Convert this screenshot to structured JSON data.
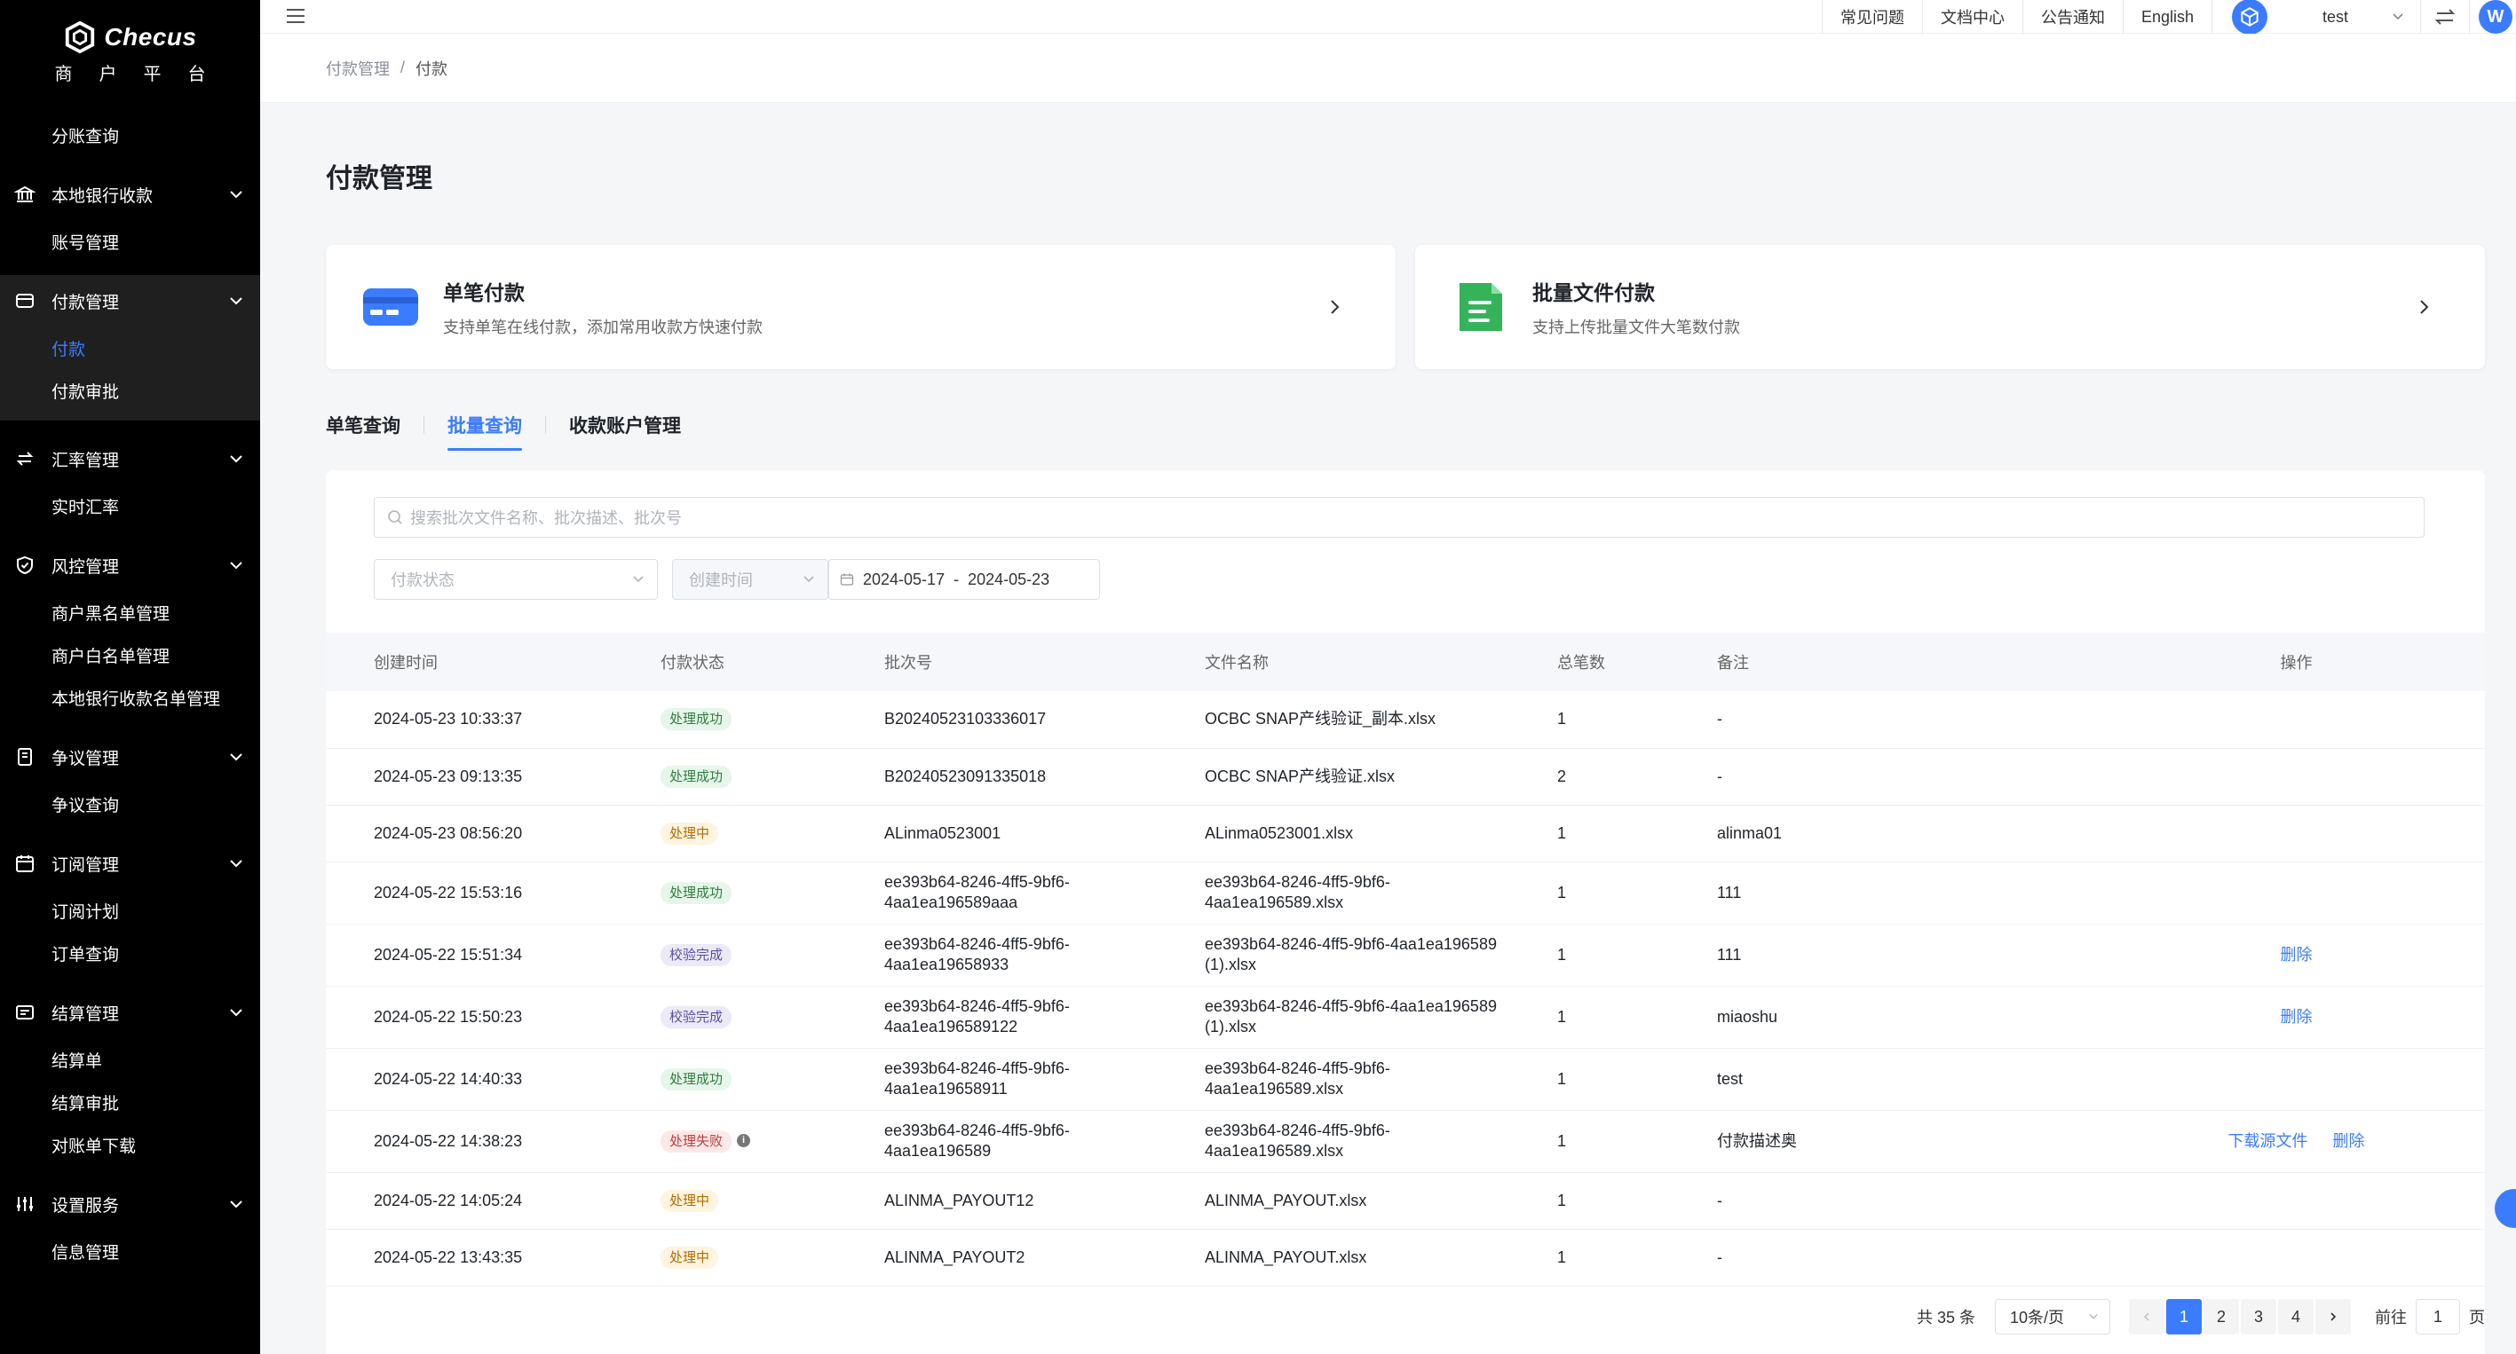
{
  "brand": {
    "name": "Checus",
    "subtitle": "商户平台"
  },
  "sidebar": {
    "top_items": [
      {
        "label": "分账查询"
      }
    ],
    "groups": [
      {
        "label": "本地银行收款",
        "icon": "bank-icon",
        "items": [
          "账号管理"
        ]
      },
      {
        "label": "付款管理",
        "icon": "payment-icon",
        "items": [
          "付款",
          "付款审批"
        ],
        "active_item": "付款"
      },
      {
        "label": "汇率管理",
        "icon": "exchange-icon",
        "items": [
          "实时汇率"
        ]
      },
      {
        "label": "风控管理",
        "icon": "shield-icon",
        "items": [
          "商户黑名单管理",
          "商户白名单管理",
          "本地银行收款名单管理"
        ]
      },
      {
        "label": "争议管理",
        "icon": "dispute-icon",
        "items": [
          "争议查询"
        ]
      },
      {
        "label": "订阅管理",
        "icon": "calendar-icon",
        "items": [
          "订阅计划",
          "订单查询"
        ]
      },
      {
        "label": "结算管理",
        "icon": "settlement-icon",
        "items": [
          "结算单",
          "结算审批",
          "对账单下载"
        ]
      },
      {
        "label": "设置服务",
        "icon": "sliders-icon",
        "items": [
          "信息管理"
        ]
      }
    ]
  },
  "topbar": {
    "links": [
      "常见问题",
      "文档中心",
      "公告通知",
      "English"
    ],
    "user": "test",
    "avatar_letter": "W"
  },
  "breadcrumb": {
    "parent": "付款管理",
    "sep": "/",
    "current": "付款"
  },
  "page_title": "付款管理",
  "cards": [
    {
      "title": "单笔付款",
      "desc": "支持单笔在线付款，添加常用收款方快速付款"
    },
    {
      "title": "批量文件付款",
      "desc": "支持上传批量文件大笔数付款"
    }
  ],
  "tabs": [
    {
      "label": "单笔查询"
    },
    {
      "label": "批量查询",
      "active": true
    },
    {
      "label": "收款账户管理"
    }
  ],
  "search": {
    "placeholder": "搜索批次文件名称、批次描述、批次号"
  },
  "filters": {
    "status_placeholder": "付款状态",
    "time_placeholder": "创建时间",
    "date_start": "2024-05-17",
    "date_sep": "-",
    "date_end": "2024-05-23"
  },
  "table": {
    "headers": [
      "创建时间",
      "付款状态",
      "批次号",
      "文件名称",
      "总笔数",
      "备注",
      "操作"
    ],
    "rows": [
      {
        "time": "2024-05-23 10:33:37",
        "status": "处理成功",
        "type": "success",
        "batch": "B20240523103336017",
        "file": "OCBC SNAP产线验证_副本.xlsx",
        "count": "1",
        "note": "-",
        "ops": []
      },
      {
        "time": "2024-05-23 09:13:35",
        "status": "处理成功",
        "type": "success",
        "batch": "B20240523091335018",
        "file": "OCBC SNAP产线验证.xlsx",
        "count": "2",
        "note": "-",
        "ops": []
      },
      {
        "time": "2024-05-23 08:56:20",
        "status": "处理中",
        "type": "processing",
        "batch": "ALinma0523001",
        "file": "ALinma0523001.xlsx",
        "count": "1",
        "note": "alinma01",
        "ops": []
      },
      {
        "time": "2024-05-22 15:53:16",
        "status": "处理成功",
        "type": "success",
        "batch": "ee393b64-8246-4ff5-9bf6-\n4aa1ea196589aaa",
        "file": "ee393b64-8246-4ff5-9bf6-\n4aa1ea196589.xlsx",
        "count": "1",
        "note": "111",
        "ops": []
      },
      {
        "time": "2024-05-22 15:51:34",
        "status": "校验完成",
        "type": "verified",
        "batch": "ee393b64-8246-4ff5-9bf6-\n4aa1ea19658933",
        "file": "ee393b64-8246-4ff5-9bf6-4aa1ea196589\n(1).xlsx",
        "count": "1",
        "note": "111",
        "ops": [
          "删除"
        ]
      },
      {
        "time": "2024-05-22 15:50:23",
        "status": "校验完成",
        "type": "verified",
        "batch": "ee393b64-8246-4ff5-9bf6-\n4aa1ea196589122",
        "file": "ee393b64-8246-4ff5-9bf6-4aa1ea196589\n(1).xlsx",
        "count": "1",
        "note": "miaoshu",
        "ops": [
          "删除"
        ]
      },
      {
        "time": "2024-05-22 14:40:33",
        "status": "处理成功",
        "type": "success",
        "batch": "ee393b64-8246-4ff5-9bf6-\n4aa1ea19658911",
        "file": "ee393b64-8246-4ff5-9bf6-\n4aa1ea196589.xlsx",
        "count": "1",
        "note": "test",
        "ops": []
      },
      {
        "time": "2024-05-22 14:38:23",
        "status": "处理失败",
        "type": "failed",
        "info": true,
        "batch": "ee393b64-8246-4ff5-9bf6-\n4aa1ea196589",
        "file": "ee393b64-8246-4ff5-9bf6-\n4aa1ea196589.xlsx",
        "count": "1",
        "note": "付款描述奥",
        "ops": [
          "下载源文件",
          "删除"
        ]
      },
      {
        "time": "2024-05-22 14:05:24",
        "status": "处理中",
        "type": "processing",
        "batch": "ALINMA_PAYOUT12",
        "file": "ALINMA_PAYOUT.xlsx",
        "count": "1",
        "note": "-",
        "ops": []
      },
      {
        "time": "2024-05-22 13:43:35",
        "status": "处理中",
        "type": "processing",
        "batch": "ALINMA_PAYOUT2",
        "file": "ALINMA_PAYOUT.xlsx",
        "count": "1",
        "note": "-",
        "ops": []
      }
    ]
  },
  "pagination": {
    "total": "共 35 条",
    "page_size": "10条/页",
    "pages": [
      "1",
      "2",
      "3",
      "4"
    ],
    "current": "1",
    "goto_label": "前往",
    "goto_value": "1",
    "page_unit": "页"
  },
  "colors": {
    "accent": "#3b7cff",
    "sidebar_bg": "#000000"
  }
}
